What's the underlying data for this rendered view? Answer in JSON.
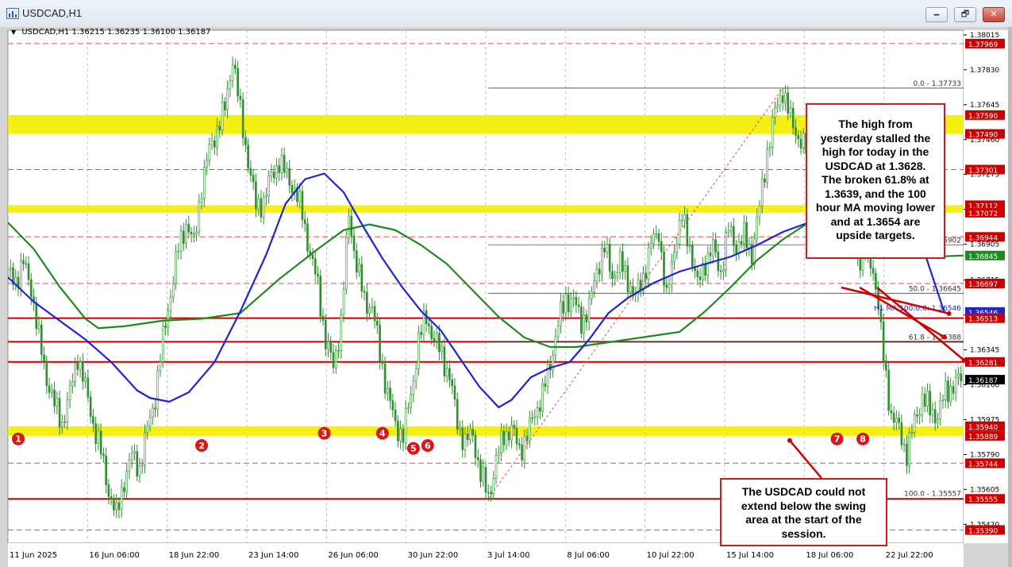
{
  "window": {
    "title": "USDCAD,H1",
    "buttons": {
      "minimize": "🗕",
      "restore": "🗗",
      "close": "✕"
    }
  },
  "ohlc_bar": {
    "symbol": "USDCAD,H1",
    "open": "1.36215",
    "high": "1.36235",
    "low": "1.36100",
    "close": "1.36187"
  },
  "chart_data": {
    "type": "line",
    "title": "",
    "xlabel": "",
    "ylabel": "",
    "ylim": [
      1.3532,
      1.3804
    ],
    "x_ticks": [
      "11 Jun 2025",
      "16 Jun 06:00",
      "18 Jun 22:00",
      "23 Jun 14:00",
      "26 Jun 06:00",
      "30 Jun 22:00",
      "3 Jul 14:00",
      "8 Jul 06:00",
      "10 Jul 22:00",
      "15 Jul 14:00",
      "18 Jul 06:00",
      "22 Jul 22:00"
    ],
    "y_ticks": [
      "1.38015",
      "1.37830",
      "1.37645",
      "1.37460",
      "1.37275",
      "1.37090",
      "1.36905",
      "1.36715",
      "1.36530",
      "1.36345",
      "1.36160",
      "1.35975",
      "1.35790",
      "1.35605",
      "1.35420"
    ],
    "price_labels": [
      {
        "text": "1.37969",
        "value": 1.37969
      },
      {
        "text": "1.37590",
        "value": 1.3759
      },
      {
        "text": "1.37490",
        "value": 1.3749
      },
      {
        "text": "1.37301",
        "value": 1.37301
      },
      {
        "text": "1.37112",
        "value": 1.37112
      },
      {
        "text": "1.37072",
        "value": 1.37072
      },
      {
        "text": "1.36944",
        "value": 1.36944
      },
      {
        "text": "1.36845",
        "value": 1.36845
      },
      {
        "text": "1.36697",
        "value": 1.36697
      },
      {
        "text": "1.36546",
        "value": 1.36546
      },
      {
        "text": "1.36513",
        "value": 1.36513
      },
      {
        "text": "1.36281",
        "value": 1.36281
      },
      {
        "text": "1.36187",
        "value": 1.36187
      },
      {
        "text": "1.35940",
        "value": 1.3594
      },
      {
        "text": "1.35889",
        "value": 1.35889
      },
      {
        "text": "1.35744",
        "value": 1.35744
      },
      {
        "text": "1.35555",
        "value": 1.35555
      },
      {
        "text": "1.35390",
        "value": 1.3539
      }
    ],
    "fib_levels": [
      {
        "text": "0.0 - 1.37733",
        "value": 1.37733
      },
      {
        "text": "1.36902",
        "value": 1.36902
      },
      {
        "text": "50.0 - 1.36645",
        "value": 1.36645
      },
      {
        "text": "61.8 - 1.36388",
        "value": 1.36388
      },
      {
        "text": "100.0 - 1.35557",
        "value": 1.35557
      }
    ],
    "ma_label": "H1 MA:100:0:0: 1.36546",
    "zones": [
      {
        "from": 1.3749,
        "to": 1.3759
      },
      {
        "from": 1.37072,
        "to": 1.37112
      },
      {
        "from": 1.35889,
        "to": 1.3594
      }
    ],
    "horizontal_lines": [
      1.37969,
      1.37301,
      1.36944,
      1.36697,
      1.36513,
      1.36388,
      1.36281,
      1.35744,
      1.35555,
      1.3539
    ],
    "price_series": [
      [
        0,
        1.3674
      ],
      [
        6,
        1.3672
      ],
      [
        12,
        1.368
      ],
      [
        18,
        1.3668
      ],
      [
        24,
        1.364
      ],
      [
        30,
        1.362
      ],
      [
        36,
        1.3605
      ],
      [
        42,
        1.3596
      ],
      [
        48,
        1.3611
      ],
      [
        54,
        1.3632
      ],
      [
        60,
        1.3614
      ],
      [
        66,
        1.3596
      ],
      [
        72,
        1.358
      ],
      [
        78,
        1.356
      ],
      [
        84,
        1.3546
      ],
      [
        90,
        1.3566
      ],
      [
        96,
        1.3578
      ],
      [
        102,
        1.3572
      ],
      [
        108,
        1.3592
      ],
      [
        114,
        1.361
      ],
      [
        120,
        1.364
      ],
      [
        126,
        1.3665
      ],
      [
        132,
        1.3688
      ],
      [
        138,
        1.3702
      ],
      [
        144,
        1.369
      ],
      [
        150,
        1.3722
      ],
      [
        156,
        1.374
      ],
      [
        162,
        1.3752
      ],
      [
        168,
        1.3762
      ],
      [
        174,
        1.379
      ],
      [
        180,
        1.376
      ],
      [
        186,
        1.3735
      ],
      [
        192,
        1.371
      ],
      [
        198,
        1.3714
      ],
      [
        204,
        1.3726
      ],
      [
        210,
        1.3735
      ],
      [
        216,
        1.3726
      ],
      [
        222,
        1.372
      ],
      [
        228,
        1.3706
      ],
      [
        234,
        1.3686
      ],
      [
        240,
        1.3668
      ],
      [
        246,
        1.364
      ],
      [
        252,
        1.3625
      ],
      [
        258,
        1.365
      ],
      [
        264,
        1.3706
      ],
      [
        270,
        1.368
      ],
      [
        276,
        1.366
      ],
      [
        282,
        1.3658
      ],
      [
        288,
        1.3632
      ],
      [
        294,
        1.3612
      ],
      [
        300,
        1.3594
      ],
      [
        306,
        1.359
      ],
      [
        312,
        1.361
      ],
      [
        318,
        1.364
      ],
      [
        324,
        1.3652
      ],
      [
        330,
        1.364
      ],
      [
        336,
        1.3632
      ],
      [
        342,
        1.362
      ],
      [
        348,
        1.3596
      ],
      [
        354,
        1.3585
      ],
      [
        360,
        1.359
      ],
      [
        366,
        1.3568
      ],
      [
        372,
        1.3557
      ],
      [
        378,
        1.3575
      ],
      [
        384,
        1.359
      ],
      [
        390,
        1.3592
      ],
      [
        396,
        1.3582
      ],
      [
        402,
        1.3588
      ],
      [
        408,
        1.3602
      ],
      [
        414,
        1.361
      ],
      [
        420,
        1.3628
      ],
      [
        426,
        1.3648
      ],
      [
        432,
        1.3662
      ],
      [
        438,
        1.366
      ],
      [
        444,
        1.365
      ],
      [
        450,
        1.3656
      ],
      [
        456,
        1.3678
      ],
      [
        462,
        1.3688
      ],
      [
        468,
        1.3674
      ],
      [
        474,
        1.368
      ],
      [
        480,
        1.3672
      ],
      [
        486,
        1.3662
      ],
      [
        492,
        1.3674
      ],
      [
        498,
        1.369
      ],
      [
        504,
        1.3698
      ],
      [
        510,
        1.366
      ],
      [
        516,
        1.369
      ],
      [
        522,
        1.3704
      ],
      [
        528,
        1.369
      ],
      [
        534,
        1.3668
      ],
      [
        540,
        1.3682
      ],
      [
        546,
        1.3688
      ],
      [
        552,
        1.3676
      ],
      [
        558,
        1.3698
      ],
      [
        564,
        1.369
      ],
      [
        570,
        1.3694
      ],
      [
        576,
        1.3686
      ],
      [
        582,
        1.371
      ],
      [
        588,
        1.374
      ],
      [
        594,
        1.376
      ],
      [
        600,
        1.3773
      ],
      [
        606,
        1.3756
      ],
      [
        612,
        1.3748
      ],
      [
        618,
        1.374
      ],
      [
        624,
        1.3725
      ],
      [
        630,
        1.373
      ],
      [
        636,
        1.3722
      ],
      [
        642,
        1.3718
      ],
      [
        648,
        1.37
      ],
      [
        654,
        1.3694
      ],
      [
        660,
        1.3682
      ],
      [
        666,
        1.3688
      ],
      [
        672,
        1.367
      ],
      [
        678,
        1.363
      ],
      [
        684,
        1.36
      ],
      [
        690,
        1.3592
      ],
      [
        696,
        1.358
      ],
      [
        702,
        1.3596
      ],
      [
        708,
        1.361
      ],
      [
        714,
        1.3602
      ],
      [
        720,
        1.36
      ],
      [
        726,
        1.3612
      ],
      [
        732,
        1.3616
      ],
      [
        738,
        1.36187
      ]
    ],
    "ma100_series": [
      [
        0,
        1.3673
      ],
      [
        20,
        1.366
      ],
      [
        40,
        1.365
      ],
      [
        60,
        1.364
      ],
      [
        80,
        1.3628
      ],
      [
        100,
        1.3613
      ],
      [
        110,
        1.3609
      ],
      [
        125,
        1.3607
      ],
      [
        140,
        1.3612
      ],
      [
        160,
        1.3628
      ],
      [
        180,
        1.3655
      ],
      [
        200,
        1.3685
      ],
      [
        215,
        1.3712
      ],
      [
        230,
        1.3725
      ],
      [
        245,
        1.3728
      ],
      [
        260,
        1.3718
      ],
      [
        275,
        1.37
      ],
      [
        290,
        1.3683
      ],
      [
        305,
        1.3668
      ],
      [
        320,
        1.3655
      ],
      [
        335,
        1.3645
      ],
      [
        350,
        1.363
      ],
      [
        365,
        1.3615
      ],
      [
        380,
        1.3604
      ],
      [
        390,
        1.3608
      ],
      [
        405,
        1.362
      ],
      [
        420,
        1.3625
      ],
      [
        435,
        1.3628
      ],
      [
        450,
        1.364
      ],
      [
        465,
        1.3654
      ],
      [
        480,
        1.3662
      ],
      [
        500,
        1.367
      ],
      [
        520,
        1.3676
      ],
      [
        540,
        1.368
      ],
      [
        560,
        1.3684
      ],
      [
        580,
        1.369
      ],
      [
        600,
        1.3697
      ],
      [
        620,
        1.3702
      ],
      [
        640,
        1.3711
      ],
      [
        660,
        1.3716
      ],
      [
        675,
        1.3718
      ],
      [
        690,
        1.3713
      ],
      [
        705,
        1.3696
      ],
      [
        725,
        1.36546
      ]
    ],
    "ma200_series": [
      [
        0,
        1.3702
      ],
      [
        20,
        1.3688
      ],
      [
        40,
        1.3668
      ],
      [
        60,
        1.3651
      ],
      [
        70,
        1.3646
      ],
      [
        90,
        1.3647
      ],
      [
        120,
        1.365
      ],
      [
        150,
        1.3651
      ],
      [
        180,
        1.3654
      ],
      [
        210,
        1.3672
      ],
      [
        240,
        1.3688
      ],
      [
        260,
        1.3698
      ],
      [
        280,
        1.3701
      ],
      [
        300,
        1.3698
      ],
      [
        320,
        1.369
      ],
      [
        340,
        1.368
      ],
      [
        360,
        1.3666
      ],
      [
        380,
        1.3652
      ],
      [
        400,
        1.3641
      ],
      [
        420,
        1.3636
      ],
      [
        440,
        1.3636
      ],
      [
        460,
        1.3638
      ],
      [
        480,
        1.364
      ],
      [
        500,
        1.3642
      ],
      [
        520,
        1.3644
      ],
      [
        540,
        1.3655
      ],
      [
        560,
        1.3668
      ],
      [
        580,
        1.3682
      ],
      [
        600,
        1.3693
      ],
      [
        620,
        1.3702
      ],
      [
        640,
        1.3707
      ],
      [
        660,
        1.3706
      ],
      [
        680,
        1.3704
      ],
      [
        700,
        1.3692
      ],
      [
        720,
        1.3684
      ],
      [
        740,
        1.36845
      ]
    ],
    "swing_markers": [
      {
        "label": "1",
        "value": 1.35915
      },
      {
        "label": "2",
        "value": 1.3588
      },
      {
        "label": "3",
        "value": 1.35945
      },
      {
        "label": "4",
        "value": 1.35945
      },
      {
        "label": "5",
        "value": 1.35865
      },
      {
        "label": "6",
        "value": 1.3588
      },
      {
        "label": "7",
        "value": 1.35915
      },
      {
        "label": "8",
        "value": 1.35915
      }
    ],
    "grid": true,
    "colors": {
      "background": "#ffffff",
      "candle": "#2f8f2f",
      "ma100": "#1e24d6",
      "ma200": "#1f8a1f",
      "zone": "#f5ee00",
      "level_line": "#cc0000",
      "dashed_level": "#e05050",
      "fib": "#444444",
      "marker": "#d81818",
      "current_price_bg": "#000000"
    }
  },
  "annotations": {
    "top": [
      "The high from",
      "yesterday stalled the",
      "high for today in the",
      "USDCAD at 1.3628.",
      "The broken 61.8% at",
      "1.3639, and the 100",
      "hour MA moving lower",
      "and at 1.3654 are",
      "upside targets."
    ],
    "bottom": [
      "The USDCAD could not",
      "extend below the swing",
      "area at the start of the",
      "session."
    ]
  }
}
